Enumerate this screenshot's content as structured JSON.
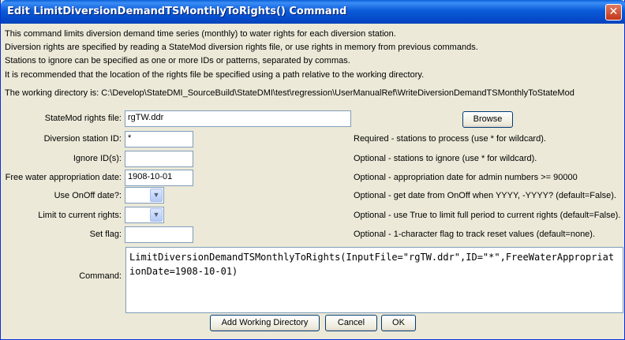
{
  "window": {
    "title": "Edit LimitDiversionDemandTSMonthlyToRights() Command",
    "close_glyph": "✕"
  },
  "info_lines": [
    "This command limits diversion demand time series (monthly) to water rights for each diversion station.",
    "Diversion rights are specified by reading a StateMod diversion rights file, or use rights in memory from previous commands.",
    "Stations to ignore can be specified as one or more IDs or patterns, separated by commas.",
    "It is recommended that the location of the rights file be specified using a path relative to the working directory.",
    "The working directory is: C:\\Develop\\StateDMI_SourceBuild\\StateDMI\\test\\regression\\UserManualRef\\WriteDiversionDemandTSMonthlyToStateMod"
  ],
  "form": {
    "rights_file": {
      "label": "StateMod rights file:",
      "value": "rgTW.ddr",
      "browse_label": "Browse"
    },
    "station_id": {
      "label": "Diversion station ID:",
      "value": "*",
      "hint": "Required - stations to process (use * for wildcard)."
    },
    "ignore_ids": {
      "label": "Ignore ID(s):",
      "value": "",
      "hint": "Optional - stations to ignore (use * for wildcard)."
    },
    "free_water": {
      "label": "Free water appropriation date:",
      "value": "1908-10-01",
      "hint": "Optional - appropriation date for admin numbers >= 90000"
    },
    "use_onoff": {
      "label": "Use OnOff date?:",
      "value": "",
      "hint": "Optional - get date from OnOff when YYYY, -YYYY? (default=False)."
    },
    "limit_current": {
      "label": "Limit to current rights:",
      "value": "",
      "hint": "Optional - use True to limit full period to current rights (default=False)."
    },
    "set_flag": {
      "label": "Set flag:",
      "value": "",
      "hint": "Optional - 1-character flag to track reset values (default=none)."
    },
    "command": {
      "label": "Command:",
      "value": "LimitDiversionDemandTSMonthlyToRights(InputFile=\"rgTW.ddr\",ID=\"*\",FreeWaterAppropriationDate=1908-10-01)"
    }
  },
  "buttons": {
    "add_working_dir": "Add Working Directory",
    "cancel": "Cancel",
    "ok": "OK"
  },
  "icons": {
    "combo_arrow": "chevron-down-icon"
  },
  "colors": {
    "titlebar": "#0a5bd8",
    "close": "#c1361a",
    "dialog_bg": "#ece9d8"
  }
}
